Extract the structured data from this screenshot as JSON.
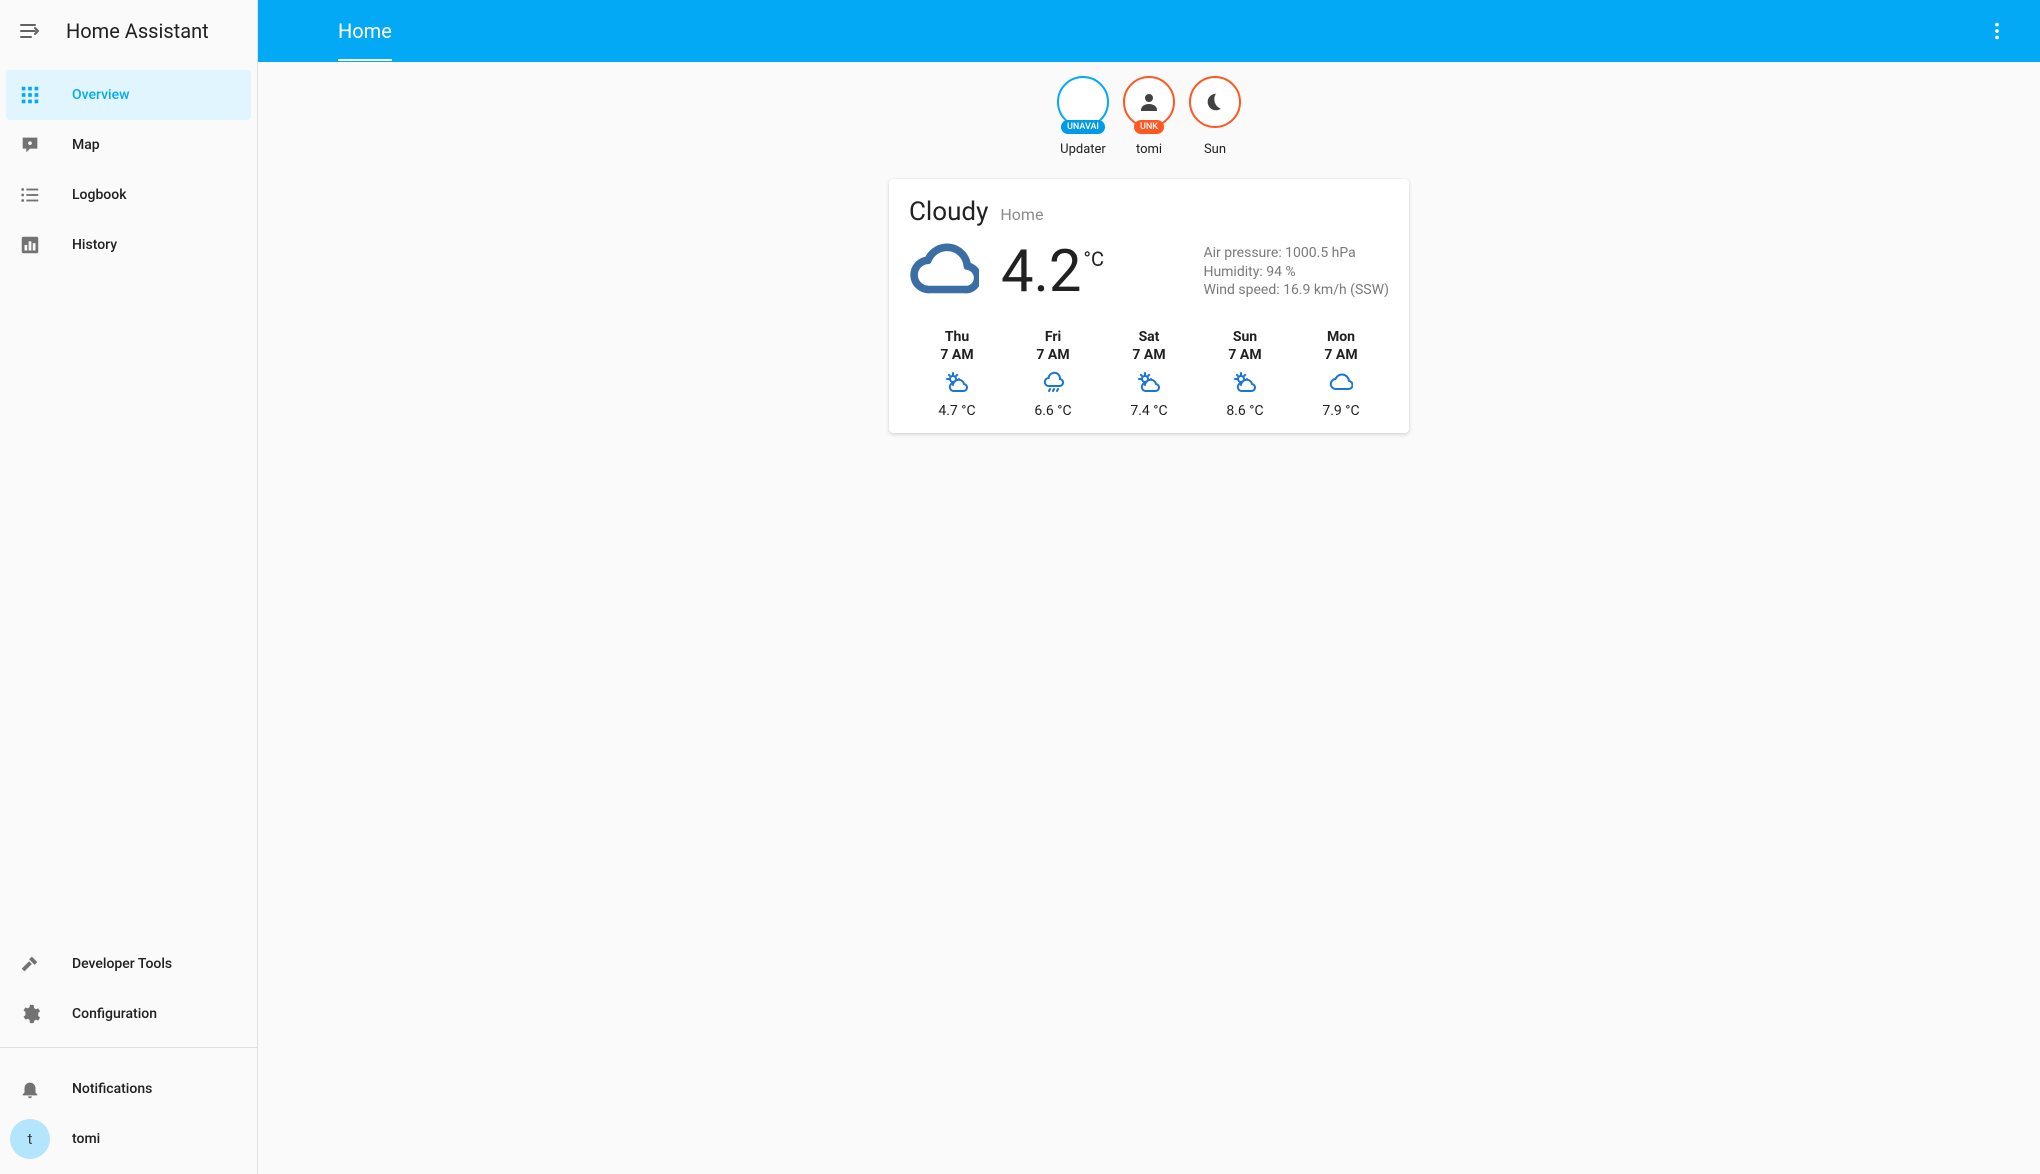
{
  "app": {
    "title": "Home Assistant"
  },
  "sidebar": {
    "items": [
      {
        "label": "Overview",
        "icon": "grid",
        "active": true
      },
      {
        "label": "Map",
        "icon": "map-pin",
        "active": false
      },
      {
        "label": "Logbook",
        "icon": "list",
        "active": false
      },
      {
        "label": "History",
        "icon": "chart",
        "active": false
      }
    ],
    "tools": [
      {
        "label": "Developer Tools",
        "icon": "hammer"
      },
      {
        "label": "Configuration",
        "icon": "gear"
      }
    ],
    "footer": {
      "notifications_label": "Notifications",
      "user": {
        "name": "tomi",
        "initial": "t"
      }
    }
  },
  "topbar": {
    "view_title": "Home"
  },
  "badges": [
    {
      "id": "updater",
      "label": "Updater",
      "border": "blue",
      "pill_text": "UNAVAI",
      "pill_color": "blue",
      "icon": null
    },
    {
      "id": "user",
      "label": "tomi",
      "border": "orange",
      "pill_text": "UNK",
      "pill_color": "orange",
      "icon": "person"
    },
    {
      "id": "sun",
      "label": "Sun",
      "border": "orange",
      "pill_text": null,
      "pill_color": null,
      "icon": "moon"
    }
  ],
  "weather": {
    "condition": "Cloudy",
    "location": "Home",
    "temperature": "4.2",
    "temperature_unit": "°C",
    "details": {
      "pressure": "Air pressure: 1000.5 hPa",
      "humidity": "Humidity: 94 %",
      "wind": "Wind speed: 16.9 km/h (SSW)"
    },
    "forecast": [
      {
        "day": "Thu",
        "time": "7 AM",
        "icon": "partly",
        "temp": "4.7 °C"
      },
      {
        "day": "Fri",
        "time": "7 AM",
        "icon": "rainy",
        "temp": "6.6 °C"
      },
      {
        "day": "Sat",
        "time": "7 AM",
        "icon": "partly",
        "temp": "7.4 °C"
      },
      {
        "day": "Sun",
        "time": "7 AM",
        "icon": "partly",
        "temp": "8.6 °C"
      },
      {
        "day": "Mon",
        "time": "7 AM",
        "icon": "cloudy",
        "temp": "7.9 °C"
      }
    ]
  }
}
